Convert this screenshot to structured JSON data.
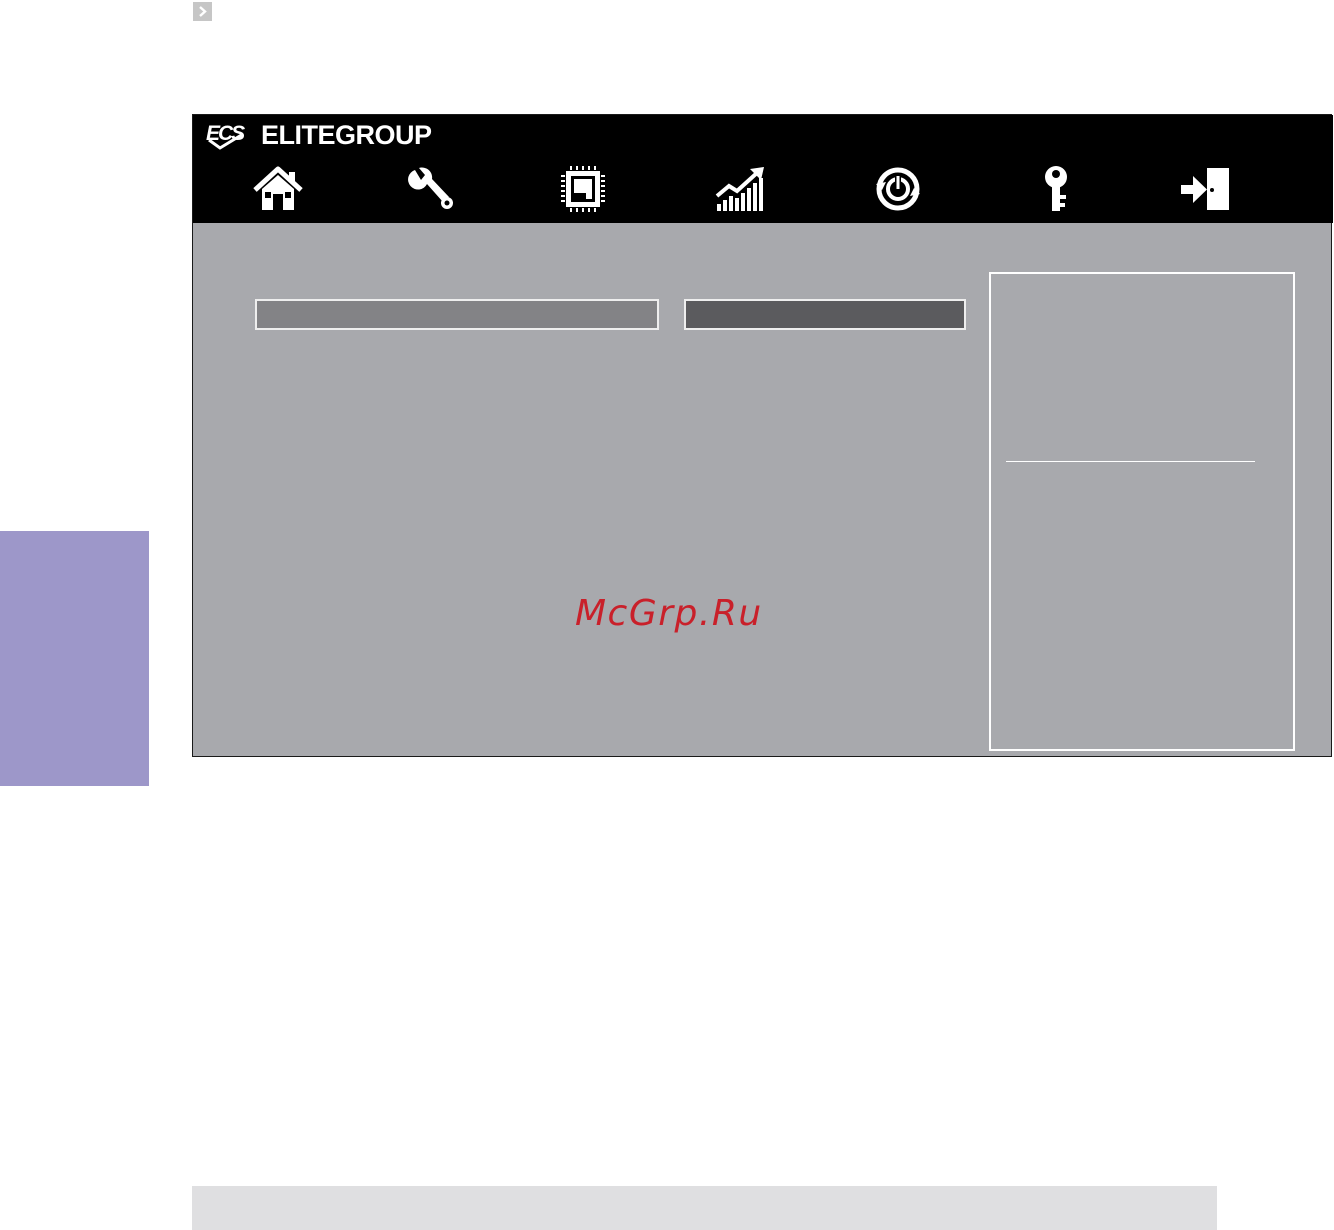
{
  "header": {
    "brand_mark": "ECS",
    "brand_name": "ELITEGROUP"
  },
  "nav": {
    "items": [
      {
        "icon": "home-icon"
      },
      {
        "icon": "wrench-icon"
      },
      {
        "icon": "chip-icon"
      },
      {
        "icon": "performance-chart-icon"
      },
      {
        "icon": "power-icon"
      },
      {
        "icon": "key-icon"
      },
      {
        "icon": "exit-door-icon"
      }
    ]
  },
  "watermark": "McGrp.Ru",
  "colors": {
    "side_tab": "#9d97c9",
    "bios_background": "#a8a9ad",
    "field_light": "#838386",
    "field_dark": "#5b5b5e",
    "watermark": "#c9202a"
  }
}
